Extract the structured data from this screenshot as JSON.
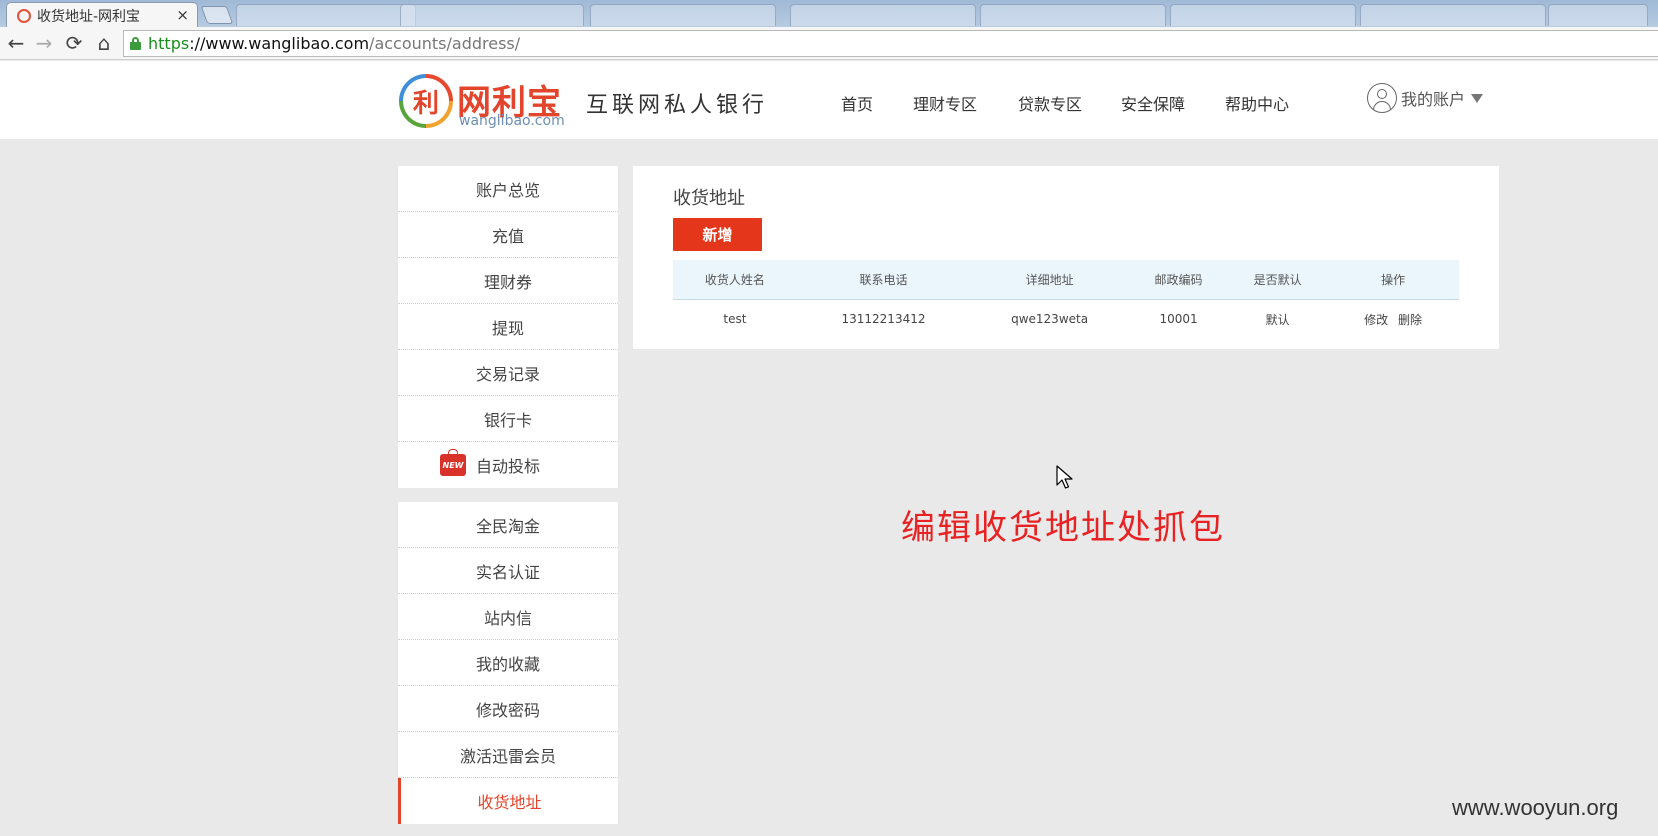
{
  "browser": {
    "tab_title": "收货地址-网利宝",
    "tab_close": "×",
    "url_https": "https",
    "url_host": "://www.wanglibao.com",
    "url_path": "/accounts/address/",
    "back_glyph": "←",
    "forward_glyph": "→",
    "reload_glyph": "⟳",
    "home_glyph": "⌂"
  },
  "header": {
    "logo_mark": "利",
    "logo_cn": "网利宝",
    "logo_en": "wanglibao.com",
    "slogan": "互联网私人银行",
    "nav": [
      "首页",
      "理财专区",
      "贷款专区",
      "安全保障",
      "帮助中心"
    ],
    "account_label": "我的账户"
  },
  "sidebar": {
    "group1": [
      "账户总览",
      "充值",
      "理财券",
      "提现",
      "交易记录",
      "银行卡",
      "自动投标"
    ],
    "new_badge": "NEW",
    "group2": [
      "全民淘金",
      "实名认证",
      "站内信",
      "我的收藏",
      "修改密码",
      "激活迅雷会员",
      "收货地址"
    ],
    "active_item": "收货地址"
  },
  "main": {
    "title": "收货地址",
    "add_button": "新增",
    "columns": [
      "收货人姓名",
      "联系电话",
      "详细地址",
      "邮政编码",
      "是否默认",
      "操作"
    ],
    "rows": [
      {
        "name": "test",
        "phone": "13112213412",
        "address": "qwe123weta",
        "zip": "10001",
        "default": "默认",
        "edit": "修改",
        "delete": "删除"
      }
    ]
  },
  "annotation": "编辑收货地址处抓包",
  "watermark": "www.wooyun.org",
  "colors": {
    "accent": "#e3361b",
    "annotation": "#e82222",
    "table_header_bg": "#eaf6fc"
  }
}
